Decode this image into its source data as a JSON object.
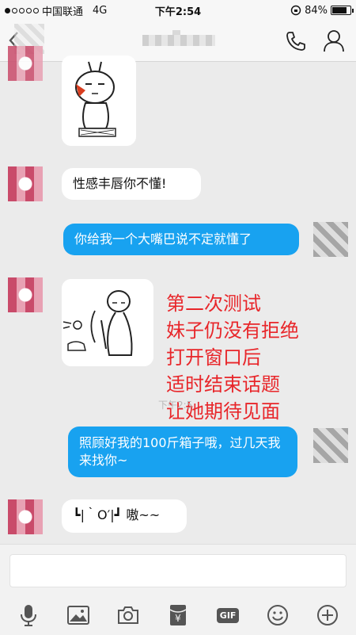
{
  "status_bar": {
    "carrier": "中国联通",
    "network": "4G",
    "time": "下午2:54",
    "battery": "84%"
  },
  "messages": {
    "m2": "性感丰唇你不懂!",
    "m3": "你给我一个大嘴巴说不定就懂了",
    "m5": "照顾好我的100斤箱子哦，过几天我来找你~",
    "m6": "┗|｀O′|┛ 嗷~~"
  },
  "caption": {
    "line1": "第二次测试",
    "line2": "妹子仍没有拒绝",
    "line3": "打开窗口后",
    "line4": "适时结束话题",
    "line5": "让她期待见面"
  },
  "timestamp": "下午2:5",
  "input": {
    "placeholder": ""
  },
  "toolbar": {
    "gif_label": "GIF",
    "yen_label": "¥"
  },
  "colors": {
    "outgoing_bubble": "#18a2f0",
    "incoming_bubble": "#ffffff",
    "caption": "#e8262a",
    "background": "#ebebeb"
  },
  "icons": [
    "back-icon",
    "phone-icon",
    "profile-icon",
    "mic-icon",
    "image-icon",
    "camera-icon",
    "red-packet-icon",
    "gif-icon",
    "emoji-icon",
    "plus-icon"
  ]
}
